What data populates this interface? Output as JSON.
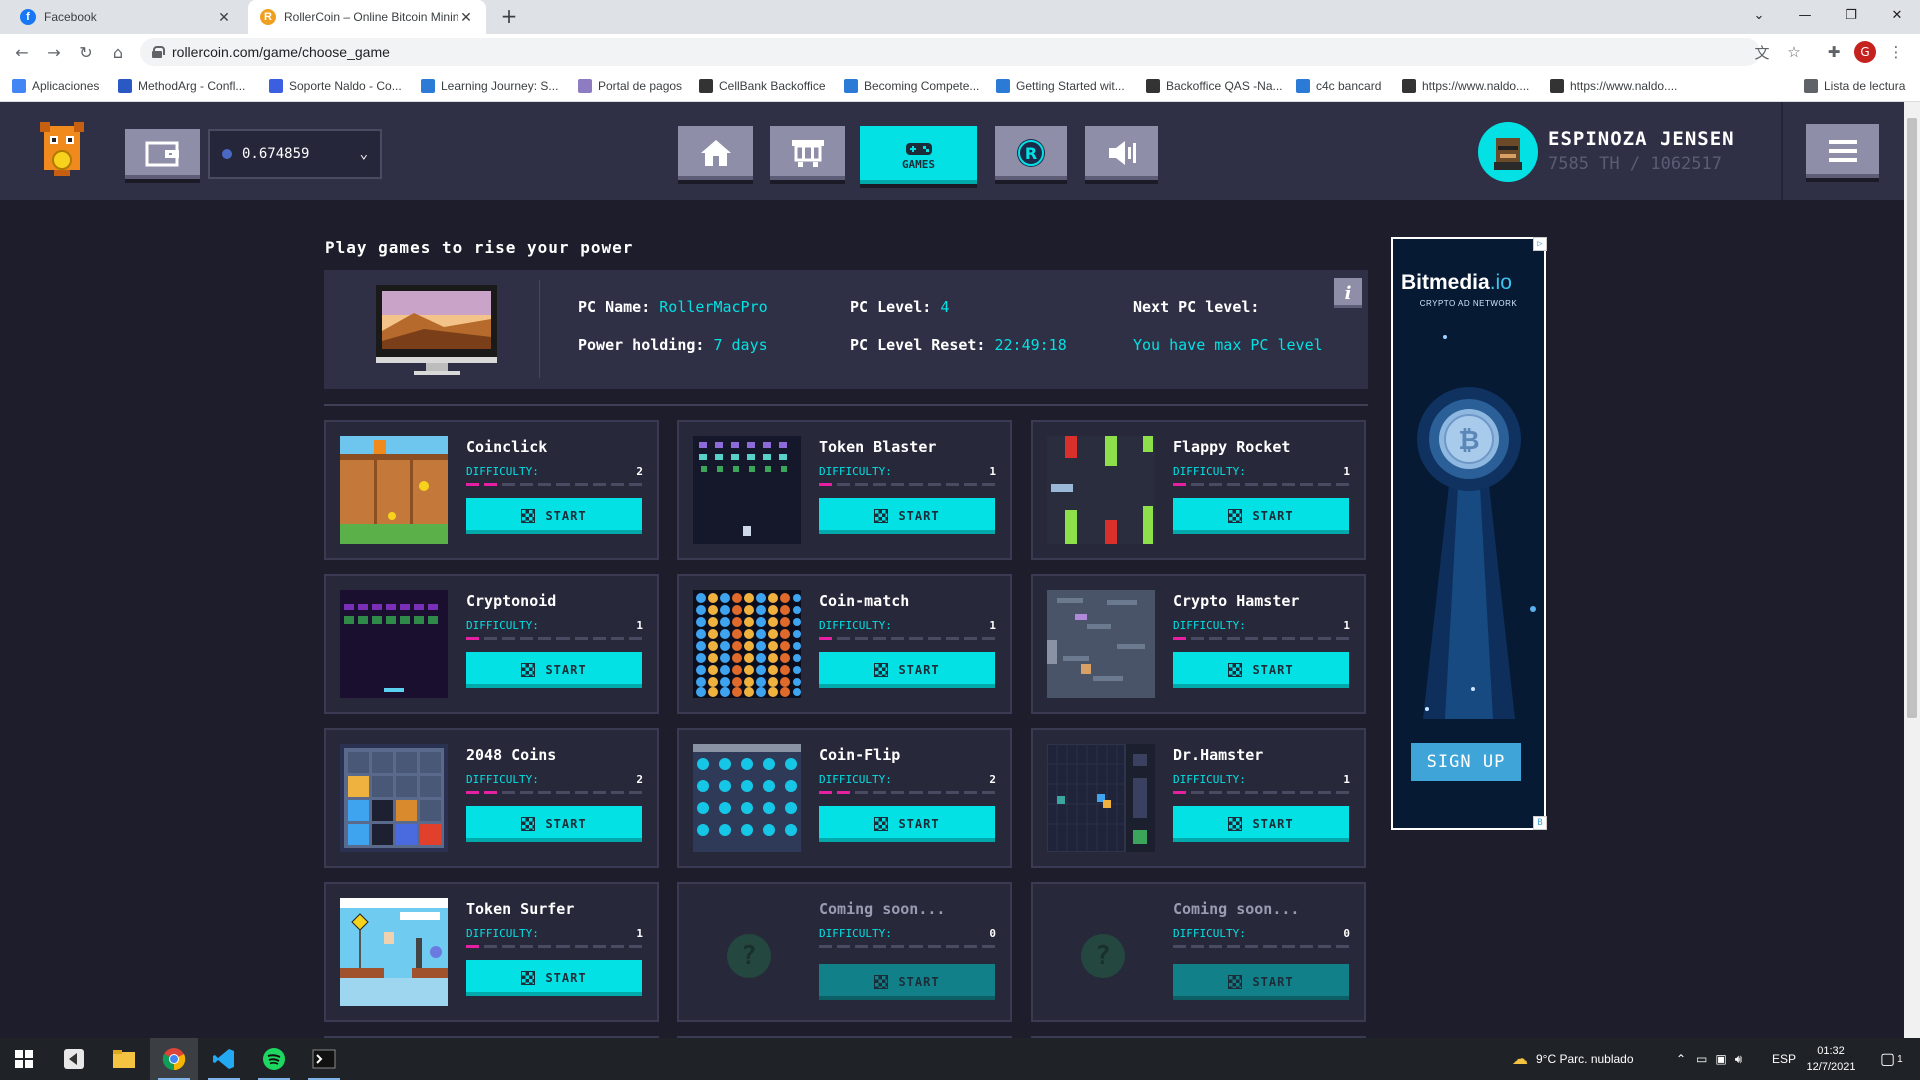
{
  "browser": {
    "tabs": [
      {
        "title": "Facebook",
        "favicon_color": "#1877f2",
        "favicon": "f"
      },
      {
        "title": "RollerCoin – Online Bitcoin Minin",
        "favicon_color": "#f0a020",
        "favicon": "R"
      }
    ],
    "url": "rollercoin.com/game/choose_game",
    "profile_initial": "G",
    "bookmarks": [
      {
        "label": "Aplicaciones",
        "color": "#4285f4"
      },
      {
        "label": "MethodArg - Confl...",
        "color": "#2b59c3"
      },
      {
        "label": "Soporte Naldo - Co...",
        "color": "#3b5fe0"
      },
      {
        "label": "Learning Journey: S...",
        "color": "#2a7ad6"
      },
      {
        "label": "Portal de pagos",
        "color": "#8e7cc3"
      },
      {
        "label": "CellBank Backoffice",
        "color": "#333333"
      },
      {
        "label": "Becoming Compete...",
        "color": "#2a7ad6"
      },
      {
        "label": "Getting Started wit...",
        "color": "#2a7ad6"
      },
      {
        "label": "Backoffice QAS -Na...",
        "color": "#333333"
      },
      {
        "label": "c4c bancard",
        "color": "#2a7ad6"
      },
      {
        "label": "https://www.naldo....",
        "color": "#333333"
      },
      {
        "label": "https://www.naldo....",
        "color": "#333333"
      }
    ],
    "reading_list": "Lista de lectura"
  },
  "header": {
    "balance": "0.674859",
    "games_label": "GAMES",
    "username": "ESPINOZA JENSEN",
    "power": "7585 TH / 1062517"
  },
  "main": {
    "title": "Play games to rise your power",
    "pc": {
      "name_label": "PC Name: ",
      "name_value": "RollerMacPro",
      "holding_label": "Power holding: ",
      "holding_value": "7 days",
      "level_label": "PC Level: ",
      "level_value": "4",
      "reset_label": "PC Level Reset: ",
      "reset_value": "22:49:18",
      "next_label": "Next PC level:",
      "next_value": "You have max PC level"
    }
  },
  "games": [
    {
      "name": "Coinclick",
      "difficulty_label": "DIFFICULTY:",
      "difficulty": 2,
      "start": "START"
    },
    {
      "name": "Token Blaster",
      "difficulty_label": "DIFFICULTY:",
      "difficulty": 1,
      "start": "START"
    },
    {
      "name": "Flappy Rocket",
      "difficulty_label": "DIFFICULTY:",
      "difficulty": 1,
      "start": "START"
    },
    {
      "name": "Cryptonoid",
      "difficulty_label": "DIFFICULTY:",
      "difficulty": 1,
      "start": "START"
    },
    {
      "name": "Coin-match",
      "difficulty_label": "DIFFICULTY:",
      "difficulty": 1,
      "start": "START"
    },
    {
      "name": "Crypto Hamster",
      "difficulty_label": "DIFFICULTY:",
      "difficulty": 1,
      "start": "START"
    },
    {
      "name": "2048 Coins",
      "difficulty_label": "DIFFICULTY:",
      "difficulty": 2,
      "start": "START"
    },
    {
      "name": "Coin-Flip",
      "difficulty_label": "DIFFICULTY:",
      "difficulty": 2,
      "start": "START"
    },
    {
      "name": "Dr.Hamster",
      "difficulty_label": "DIFFICULTY:",
      "difficulty": 1,
      "start": "START"
    },
    {
      "name": "Token Surfer",
      "difficulty_label": "DIFFICULTY:",
      "difficulty": 1,
      "start": "START"
    },
    {
      "name": "Coming soon...",
      "difficulty_label": "DIFFICULTY:",
      "difficulty": 0,
      "start": "START"
    },
    {
      "name": "Coming soon...",
      "difficulty_label": "DIFFICULTY:",
      "difficulty": 0,
      "start": "START"
    }
  ],
  "ad": {
    "brand": "Bitmedia",
    "brand_suffix": ".io",
    "tagline": "CRYPTO AD NETWORK",
    "cta": "SIGN UP"
  },
  "taskbar": {
    "weather": "9°C  Parc. nublado",
    "lang": "ESP",
    "time": "01:32",
    "date": "12/7/2021",
    "notifications": "1"
  },
  "colors": {
    "accent": "#03e1e4",
    "difficulty_on": "#e61fa3",
    "panel": "#2f3045"
  }
}
